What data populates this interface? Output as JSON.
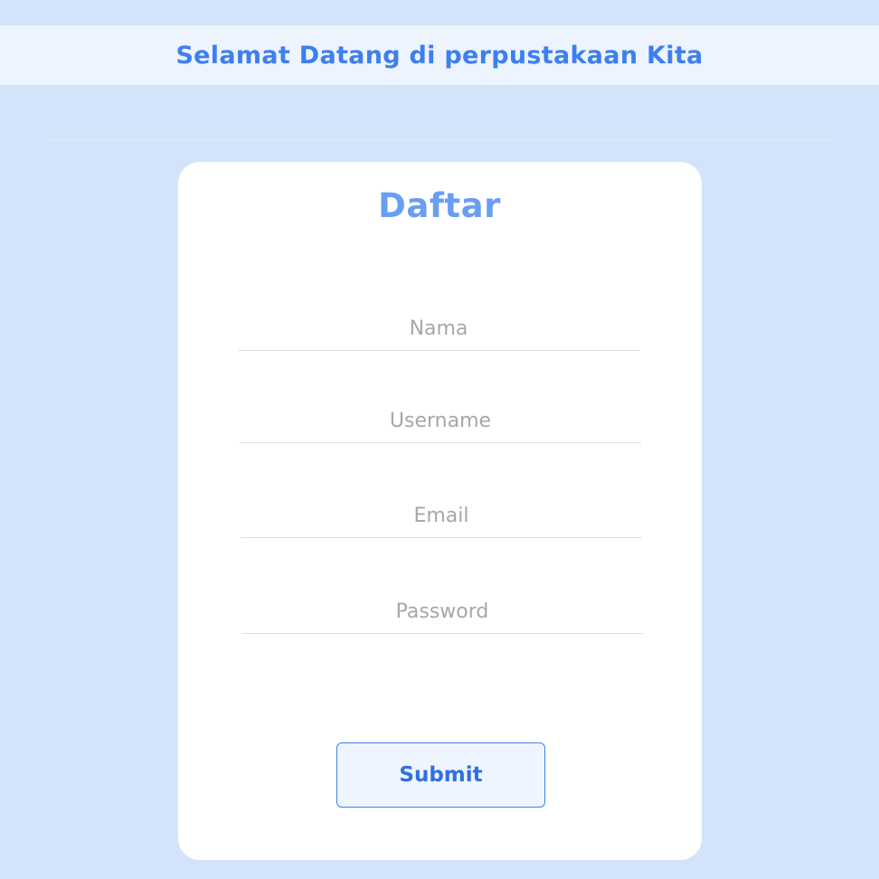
{
  "header": {
    "title": "Selamat Datang di perpustakaan Kita"
  },
  "form": {
    "heading": "Daftar",
    "fields": [
      {
        "placeholder": "Nama",
        "value": ""
      },
      {
        "placeholder": "Username",
        "value": ""
      },
      {
        "placeholder": "Email",
        "value": ""
      },
      {
        "placeholder": "Password",
        "value": ""
      }
    ],
    "submit_label": "Submit"
  },
  "colors": {
    "page_background": "#d3e3fa",
    "header_band": "#edf4fd",
    "accent": "#3e7ff0",
    "heading": "#6a9ef2",
    "card": "#ffffff",
    "field_underline": "#dcdfe4",
    "placeholder": "#a7a7a7"
  }
}
